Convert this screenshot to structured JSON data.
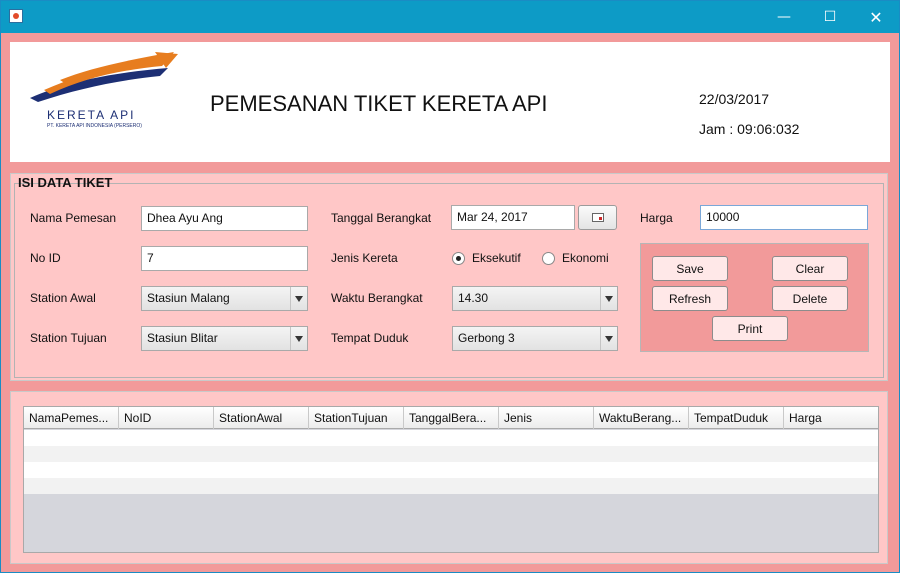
{
  "window": {
    "minimize_glyph": "—",
    "maximize_glyph": "☐",
    "close_glyph": "✕"
  },
  "header": {
    "logo_text": "KERETA API",
    "logo_subtext": "PT. KERETA API INDONESIA (PERSERO)",
    "title": "PEMESANAN TIKET KERETA API",
    "date": "22/03/2017",
    "clock": "Jam : 09:06:032"
  },
  "form": {
    "section_title": "ISI DATA TIKET",
    "nama_label": "Nama Pemesan",
    "nama_value": "Dhea Ayu Ang",
    "noid_label": "No ID",
    "noid_value": "7",
    "station_awal_label": "Station Awal",
    "station_awal_value": "Stasiun Malang",
    "station_tujuan_label": "Station Tujuan",
    "station_tujuan_value": "Stasiun Blitar",
    "tanggal_label": "Tanggal Berangkat",
    "tanggal_value": "Mar 24, 2017",
    "jenis_label": "Jenis Kereta",
    "jenis_options": [
      "Eksekutif",
      "Ekonomi"
    ],
    "jenis_selected": "Eksekutif",
    "waktu_label": "Waktu Berangkat",
    "waktu_value": "14.30",
    "tempat_label": "Tempat Duduk",
    "tempat_value": "Gerbong 3",
    "harga_label": "Harga",
    "harga_value": "10000"
  },
  "buttons": {
    "save": "Save",
    "clear": "Clear",
    "refresh": "Refresh",
    "delete": "Delete",
    "print": "Print"
  },
  "table": {
    "columns": [
      "NamaPemes...",
      "NoID",
      "StationAwal",
      "StationTujuan",
      "TanggalBera...",
      "Jenis",
      "WaktuBerang...",
      "TempatDuduk",
      "Harga"
    ],
    "rows": []
  },
  "colors": {
    "titlebar": "#0d9bc6",
    "background": "#f29a9a",
    "panel": "#ffc7c7",
    "header": "#ffffff"
  }
}
